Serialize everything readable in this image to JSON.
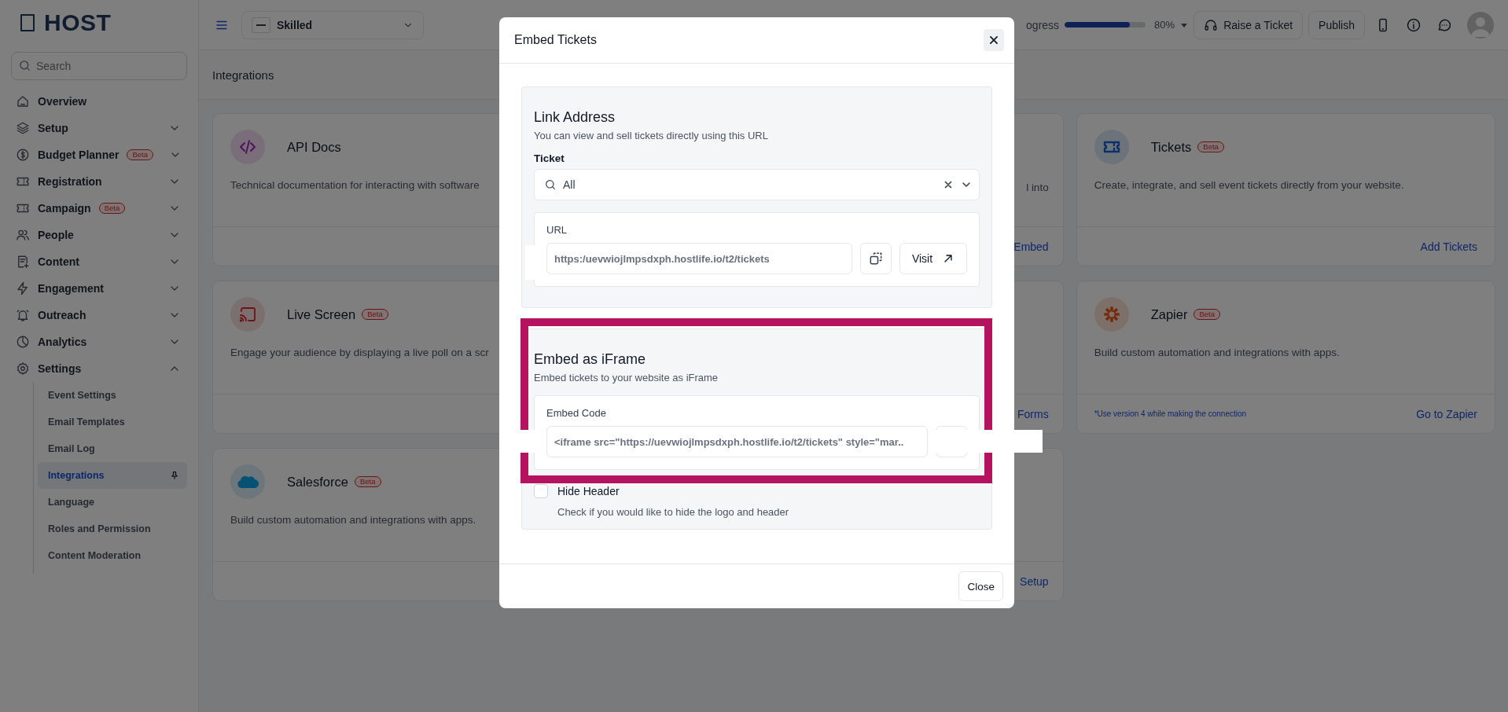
{
  "sidebar": {
    "logo": "HOST",
    "search": {
      "placeholder": "Search"
    },
    "items": [
      {
        "label": "Overview",
        "kind": "link"
      },
      {
        "label": "Setup",
        "kind": "group",
        "expanded": false
      },
      {
        "label": "Budget Planner",
        "kind": "group",
        "expanded": false,
        "badge": "Beta"
      },
      {
        "label": "Registration",
        "kind": "group",
        "expanded": false
      },
      {
        "label": "Campaign",
        "kind": "group",
        "expanded": false,
        "badge": "Beta"
      },
      {
        "label": "People",
        "kind": "group",
        "expanded": false
      },
      {
        "label": "Content",
        "kind": "group",
        "expanded": false
      },
      {
        "label": "Engagement",
        "kind": "group",
        "expanded": false
      },
      {
        "label": "Outreach",
        "kind": "group",
        "expanded": false
      },
      {
        "label": "Analytics",
        "kind": "group",
        "expanded": false
      },
      {
        "label": "Settings",
        "kind": "group",
        "expanded": true,
        "children": [
          {
            "label": "Event Settings",
            "selected": false
          },
          {
            "label": "Email Templates",
            "selected": false
          },
          {
            "label": "Email Log",
            "selected": false
          },
          {
            "label": "Integrations",
            "selected": true
          },
          {
            "label": "Language",
            "selected": false
          },
          {
            "label": "Roles and Permission",
            "selected": false
          },
          {
            "label": "Content Moderation",
            "selected": false
          }
        ]
      }
    ]
  },
  "topbar": {
    "event": {
      "name": "Skilled"
    },
    "progress": {
      "label": "ogress",
      "level": 0.8,
      "reading": "80%"
    },
    "buttons": [
      "Raise a Ticket",
      "Publish"
    ]
  },
  "page_title": "Integrations",
  "cards": [
    {
      "title": "API Docs",
      "description": "Technical documentation for interacting with software"
    },
    {
      "description": "l into",
      "action": "Embed"
    },
    {
      "title": "Tickets",
      "badge": "Beta",
      "description": "Create, integrate, and sell event tickets directly from your website.",
      "action": "Add Tickets"
    },
    {
      "title": "Live Screen",
      "badge": "Beta",
      "description": "Engage your audience by displaying a live poll on a scr"
    },
    {
      "action": "Forms"
    },
    {
      "title": "Zapier",
      "badge": "Beta",
      "description": "Build custom automation and integrations with apps.",
      "note": "*Use version 4 while making the connection",
      "action": "Go to Zapier"
    },
    {
      "title": "Salesforce",
      "badge": "Beta",
      "description": "Build custom automation and integrations with apps."
    },
    {
      "action": "Setup"
    }
  ],
  "modal": {
    "title": "Embed Tickets",
    "link_section": {
      "title": "Link Address",
      "subtitle": "You can view and sell tickets directly using this URL",
      "ticket_label": "Ticket",
      "ticket_value": "All",
      "url_label": "URL",
      "url": "https:/uevwiojlmpsdxph.hostlife.io/t2/tickets",
      "visit_button": "Visit"
    },
    "embed_section": {
      "title": "Embed as iFrame",
      "subtitle": "Embed tickets to your website as iFrame",
      "code_label": "Embed Code",
      "code": "<iframe src=\"https://uevwiojlmpsdxph.hostlife.io/t2/tickets\" style=\"mar.."
    },
    "hide_header": {
      "label": "Hide Header",
      "checked": false,
      "description": "Check if you would like to hide the logo and header"
    },
    "close_button": "Close"
  }
}
